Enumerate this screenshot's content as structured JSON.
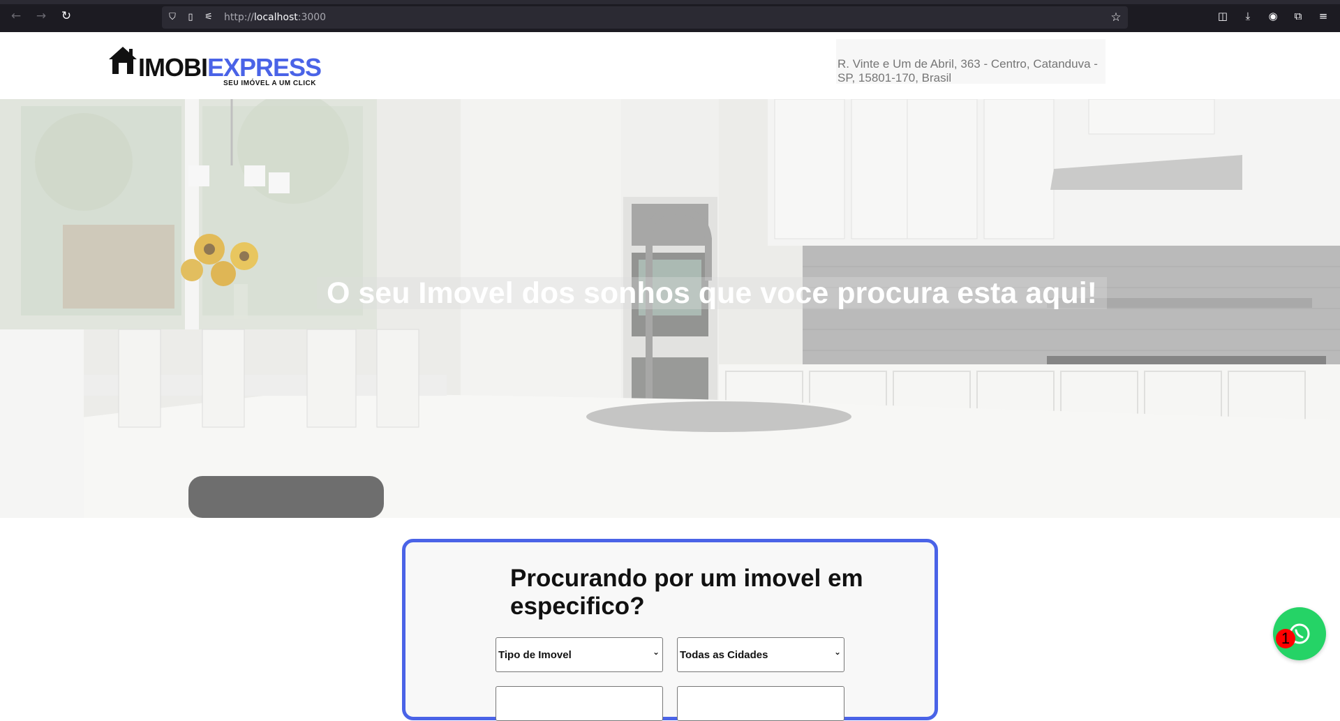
{
  "browser": {
    "url_prefix": "http://",
    "url_host": "localhost",
    "url_port": ":3000"
  },
  "header": {
    "logo_text_dark": "IMOBI",
    "logo_text_blue": "EXPRESS",
    "logo_tagline": "SEU IMÓVEL A UM  CLICK",
    "address": "R. Vinte e Um de Abril, 363 - Centro, Catanduva - SP, 15801-170, Brasil"
  },
  "hero": {
    "title": "O seu Imovel dos sonhos que voce procura esta aqui!"
  },
  "search": {
    "title": "Procurando por um imovel em especifico?",
    "property_type_selected": "Tipo de Imovel",
    "city_selected": "Todas as Cidades"
  },
  "whatsapp": {
    "badge_count": "1"
  },
  "colors": {
    "brand_blue": "#4a63e7",
    "whatsapp_green": "#25d366",
    "badge_red": "#ff0000"
  }
}
